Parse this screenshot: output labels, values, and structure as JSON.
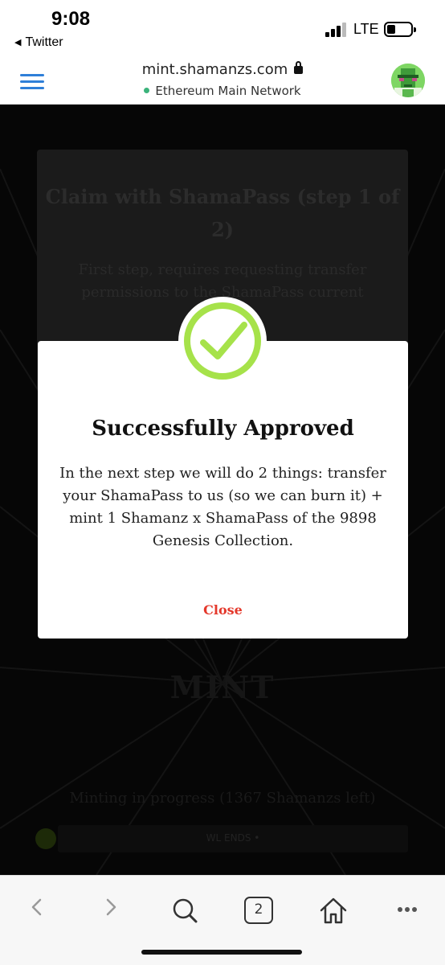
{
  "status_bar": {
    "time": "9:08",
    "back_app": "Twitter",
    "carrier": "LTE"
  },
  "address_bar": {
    "url": "mint.shamanzs.com",
    "network": "Ethereum Main Network",
    "network_status_color": "#3bb37b",
    "accent_color": "#2f7fd8",
    "icons": [
      "hamburger-menu-icon",
      "lock-icon",
      "account-avatar"
    ]
  },
  "background_page": {
    "card_title": "Claim with ShamaPass (step 1 of 2)",
    "card_description": "First step, requires requesting transfer permissions to the ShamaPass current",
    "mint_heading": "MINT",
    "progress_text": "Minting in progress (1367 Shamanzs left)",
    "bar_label": "WL ENDS •"
  },
  "modal": {
    "icon": "checkmark-circle-icon",
    "icon_color": "#a6e24a",
    "title": "Successfully Approved",
    "body": "In the next step we will do 2 things: transfer your ShamaPass to us (so we can burn it) + mint 1 Shamanz x ShamaPass of the 9898 Genesis Collection.",
    "close_label": "Close",
    "close_color": "#e4382b"
  },
  "toolbar": {
    "tab_count": "2",
    "icons": [
      "back-icon",
      "forward-icon",
      "search-icon",
      "tabs-icon",
      "home-icon",
      "more-icon"
    ]
  }
}
